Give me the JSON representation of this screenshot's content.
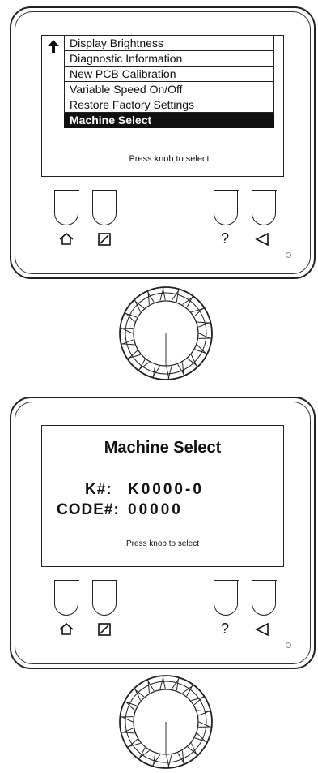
{
  "panel1": {
    "menu_items": [
      {
        "label": "Display Brightness"
      },
      {
        "label": "Diagnostic Information"
      },
      {
        "label": "New PCB Calibration"
      },
      {
        "label": "Variable Speed On/Off"
      },
      {
        "label": "Restore Factory Settings"
      },
      {
        "label": "Machine Select"
      }
    ],
    "selected_index": 5,
    "hint": "Press knob to select"
  },
  "panel2": {
    "title": "Machine Select",
    "k_label": "K#:",
    "k_value": "K0000-0",
    "code_label": "CODE#:",
    "code_value": "00000",
    "hint": "Press knob to select"
  },
  "buttons": {
    "home_icon": "home-icon",
    "edit_icon": "edit-icon",
    "help_label": "?",
    "back_icon": "back-triangle-icon"
  }
}
